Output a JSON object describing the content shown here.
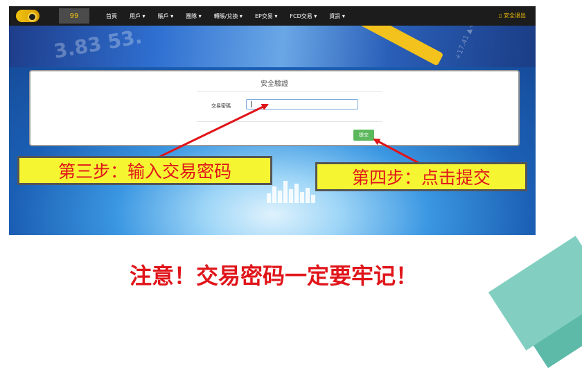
{
  "navbar": {
    "user_badge": "99",
    "menu": [
      {
        "label": "首頁"
      },
      {
        "label": "用戶 ▾"
      },
      {
        "label": "賬戶 ▾"
      },
      {
        "label": "團隊 ▾"
      },
      {
        "label": "轉賬/兌換 ▾"
      },
      {
        "label": "EP交易 ▾"
      },
      {
        "label": "FCD交易 ▾"
      },
      {
        "label": "資訊 ▾"
      }
    ],
    "logout_label": "▯ 安全退出",
    "logo_icon": "logo-badge-icon"
  },
  "banner": {
    "number_text": "3.83 53.",
    "side_numbers": "+17.41 ▲+3"
  },
  "card": {
    "title": "安全驗證",
    "field_label": "交易密碼",
    "field_value": "",
    "submit_label": "提交"
  },
  "annotations": {
    "step3": "第三步：输入交易密码",
    "step4": "第四步：点击提交",
    "note": "注意！交易密码一定要牢记！"
  },
  "colors": {
    "navbar_bg": "#1c1c1c",
    "accent_gold": "#f1c10c",
    "submit_green": "#5cb85c",
    "callout_yellow": "#f5f532",
    "annotation_red": "#e0151a",
    "teal": "#82cfc1"
  }
}
